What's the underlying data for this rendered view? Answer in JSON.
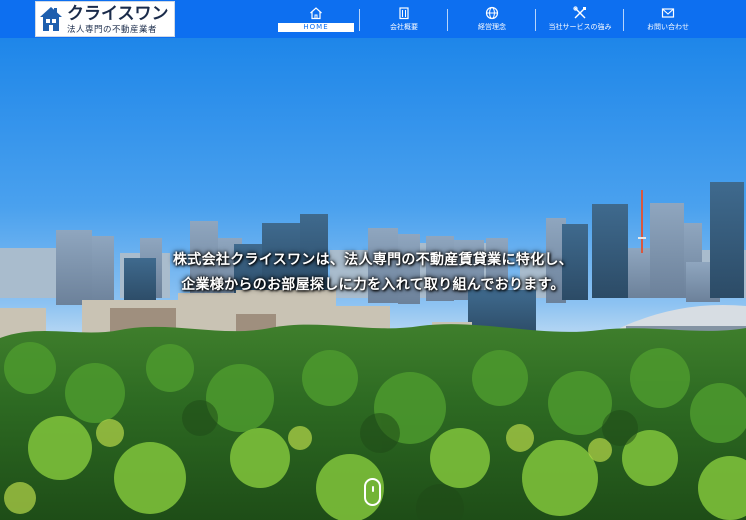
{
  "colors": {
    "header_bg": "#0d6ff0",
    "accent_white": "#ffffff",
    "logo_text": "#1a2b4a"
  },
  "logo": {
    "title": "クライスワン",
    "subtitle": "法人専門の不動産業者",
    "icon": "house-icon"
  },
  "nav": {
    "items": [
      {
        "label": "HOME",
        "icon": "home-icon",
        "active": true
      },
      {
        "label": "会社概要",
        "icon": "building-icon",
        "active": false
      },
      {
        "label": "経営理念",
        "icon": "globe-icon",
        "active": false
      },
      {
        "label": "当社サービスの強み",
        "icon": "tools-icon",
        "active": false
      },
      {
        "label": "お問い合わせ",
        "icon": "mail-icon",
        "active": false
      }
    ]
  },
  "hero": {
    "line1": "株式会社クライスワンは、法人専門の不動産賃貸業に特化し、",
    "line2": "企業様からのお部屋探しに力を入れて取り組んでおります。",
    "scroll_icon": "scroll-down-icon"
  }
}
